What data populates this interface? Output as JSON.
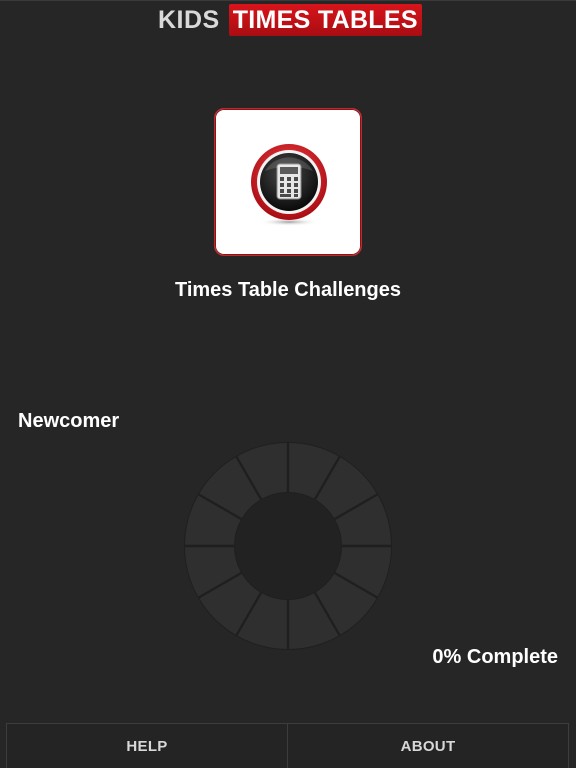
{
  "header": {
    "logo_kids": "KIDS",
    "logo_times_tables": "TIMES TABLES"
  },
  "challenge": {
    "icon": "calculator-icon",
    "label": "Times Table Challenges"
  },
  "progress": {
    "rank": "Newcomer",
    "segments_total": 12,
    "segments_complete": 0,
    "percent": 0,
    "complete_label": "0% Complete"
  },
  "footer": {
    "help_label": "HELP",
    "about_label": "ABOUT"
  },
  "colors": {
    "background": "#262626",
    "accent_red": "#d8141b",
    "segment_empty": "#2f2f2f",
    "segment_complete": "#d8141b"
  }
}
